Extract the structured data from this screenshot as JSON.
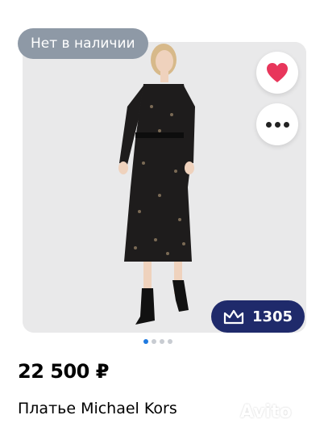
{
  "listing": {
    "stock_badge": "Нет в наличии",
    "price": "22 500 ₽",
    "title": "Платье Michael Kors",
    "views_count": "1305",
    "watermark": "Avito",
    "photo_index": 1,
    "photo_count": 4
  },
  "colors": {
    "favorite_heart": "#e8365b",
    "views_badge_bg": "#1f2a6b",
    "pager_active": "#1f7ae0",
    "stock_badge_bg": "#8e99a6"
  },
  "icons": {
    "favorite": "heart-icon",
    "more": "more-dots-icon",
    "views": "crown-icon"
  }
}
